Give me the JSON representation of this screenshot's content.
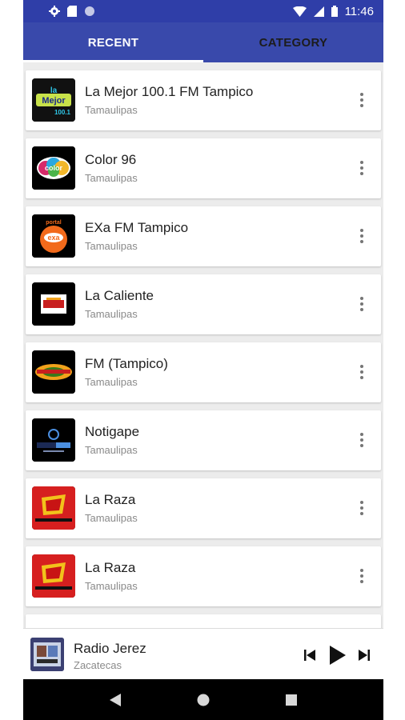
{
  "status_bar": {
    "time": "11:46",
    "left_icons": [
      "gear-icon",
      "sd-card-icon",
      "circle-icon"
    ],
    "right_icons": [
      "wifi-icon",
      "signal-icon",
      "battery-icon"
    ]
  },
  "tabs": [
    {
      "label": "RECENT",
      "active": true
    },
    {
      "label": "CATEGORY",
      "active": false
    }
  ],
  "stations": [
    {
      "name": "La Mejor 100.1 FM Tampico",
      "region": "Tamaulipas",
      "logo": "la-mejor-logo"
    },
    {
      "name": "Color 96",
      "region": "Tamaulipas",
      "logo": "color-96-logo"
    },
    {
      "name": "EXa FM Tampico",
      "region": "Tamaulipas",
      "logo": "exa-fm-logo"
    },
    {
      "name": "La Caliente",
      "region": "Tamaulipas",
      "logo": "la-caliente-logo"
    },
    {
      "name": "FM (Tampico)",
      "region": "Tamaulipas",
      "logo": "fm-tampico-logo"
    },
    {
      "name": "Notigape",
      "region": "Tamaulipas",
      "logo": "notigape-logo"
    },
    {
      "name": "La Raza",
      "region": "Tamaulipas",
      "logo": "la-raza-logo"
    },
    {
      "name": "La Raza",
      "region": "Tamaulipas",
      "logo": "la-raza-logo"
    }
  ],
  "now_playing": {
    "title": "Radio Jerez",
    "subtitle": "Zacatecas",
    "controls": [
      "skip-previous-icon",
      "play-icon",
      "skip-next-icon"
    ]
  },
  "nav_bar": [
    "back-icon",
    "home-icon",
    "recents-icon"
  ],
  "colors": {
    "status_bar": "#2f3ea8",
    "tab_bar": "#3949ab",
    "background": "#ececec"
  }
}
